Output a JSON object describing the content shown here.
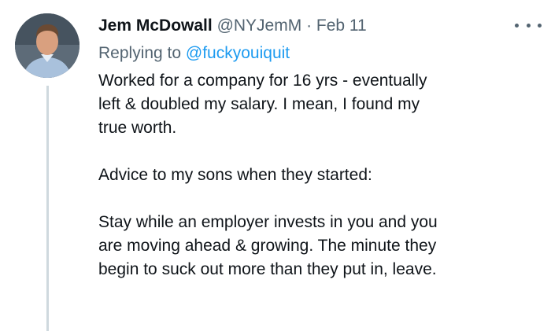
{
  "tweet": {
    "author_name": "Jem McDowall",
    "handle": "@NYJemM",
    "separator": "·",
    "date": "Feb 11",
    "replying_prefix": "Replying to ",
    "replying_to": "@fuckyouiquit",
    "paragraphs": [
      [
        "Worked for a company for 16 yrs - eventually",
        "left & doubled my salary. I mean, I found my",
        "true worth."
      ],
      [
        "Advice to my sons when they started:"
      ],
      [
        "Stay while an employer invests in you and you",
        "are moving ahead & growing. The minute they",
        "begin to suck out more than they put in, leave."
      ]
    ]
  },
  "icons": {
    "more": "more-options-icon",
    "avatar": "avatar"
  },
  "colors": {
    "link": "#1d9bf0",
    "muted": "#536471",
    "text": "#0f1419",
    "thread": "#cfd9de"
  }
}
